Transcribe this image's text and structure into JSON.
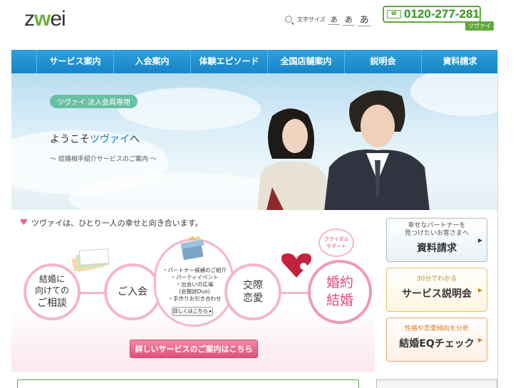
{
  "header": {
    "logo": "zwei",
    "font_size_label": "文字サイズ",
    "font_sizes": [
      "あ",
      "あ",
      "あ"
    ],
    "phone_number": "0120-277-281",
    "phone_tag": "ツヴァイ"
  },
  "nav": {
    "items": [
      "サービス案内",
      "入会案内",
      "体験エピソード",
      "全国店舗案内",
      "説明会",
      "資料請求"
    ]
  },
  "hero": {
    "badge": "ツヴァイ 法人会員専用",
    "welcome_prefix": "ようこそ",
    "welcome_brand": "ツヴァイ",
    "welcome_suffix": "へ",
    "subtitle": "〜 結婚相手紹介サービスのご案内 〜"
  },
  "flow": {
    "tagline": "ツヴァイは、ひとり一人の幸せと向き合います。",
    "step1": [
      "結婚に",
      "向けての",
      "ご相談"
    ],
    "step2": "ご入会",
    "step3": [
      "交際",
      "恋愛"
    ],
    "step4": [
      "婚約",
      "結婚"
    ],
    "bridal": [
      "ブライダル",
      "サポート"
    ],
    "services": [
      "・パートナー候補のご紹介",
      "・パーティイベント",
      "・出会いの広場",
      "(会報誌Duo)",
      "・手作りお引き合わせ"
    ],
    "more_label": "詳しくはこちら",
    "detail_button": "詳しいサービスのご案内はこちら"
  },
  "side": {
    "materials": {
      "small": [
        "幸せなパートナーを",
        "見つけたいお客さまへ"
      ],
      "large": "資料請求"
    },
    "seminar": {
      "small": "30分でわかる",
      "large": "サービス説明会"
    },
    "eq": {
      "small": "性格や恋愛傾向を分析",
      "large": "結婚EQチェック"
    }
  },
  "colors": {
    "nav_blue": "#1f91d2",
    "brand_green": "#5fa93b",
    "pink": "#e3487c"
  }
}
